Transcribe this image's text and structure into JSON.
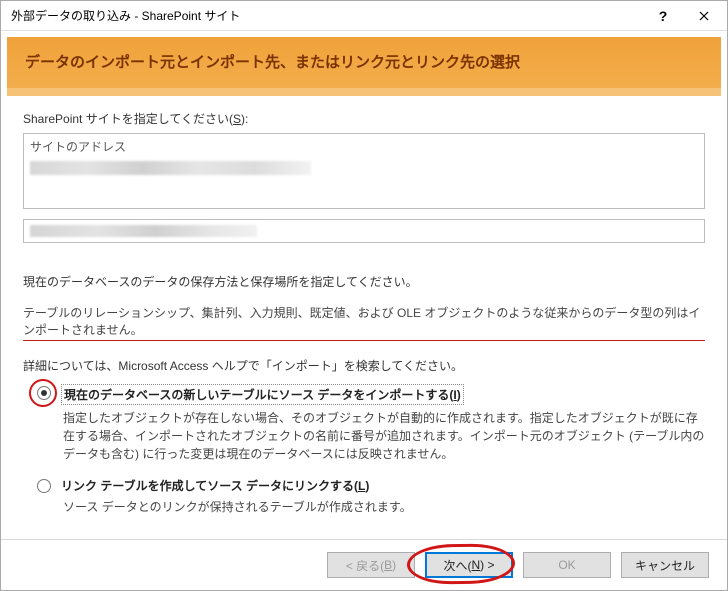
{
  "window": {
    "title": "外部データの取り込み - SharePoint サイト"
  },
  "banner": {
    "title": "データのインポート元とインポート先、またはリンク元とリンク先の選択"
  },
  "site_section": {
    "label_prefix": "SharePoint サイトを指定してください(",
    "label_key": "S",
    "label_suffix": "):",
    "listbox_header": "サイトのアドレス"
  },
  "instructions": {
    "storage_line": "現在のデータベースのデータの保存方法と保存場所を指定してください。",
    "warning_line": "テーブルのリレーションシップ、集計列、入力規則、既定値、および OLE オブジェクトのような従来からのデータ型の列はインポートされません。",
    "help_line": "詳細については、Microsoft Access ヘルプで「インポート」を検索してください。"
  },
  "options": {
    "import_new": {
      "label_prefix": "現在のデータベースの新しいテーブルにソース データをインポートする(",
      "label_key": "I",
      "label_suffix": ")",
      "desc": "指定したオブジェクトが存在しない場合、そのオブジェクトが自動的に作成されます。指定したオブジェクトが既に存在する場合、インポートされたオブジェクトの名前に番号が追加されます。インポート元のオブジェクト (テーブル内のデータも含む) に行った変更は現在のデータベースには反映されません。",
      "checked": true
    },
    "link_table": {
      "label_prefix": "リンク テーブルを作成してソース データにリンクする(",
      "label_key": "L",
      "label_suffix": ")",
      "desc": "ソース データとのリンクが保持されるテーブルが作成されます。",
      "checked": false
    }
  },
  "buttons": {
    "back_prefix": "< 戻る(",
    "back_key": "B",
    "back_suffix": ")",
    "next_prefix": "次へ(",
    "next_key": "N",
    "next_suffix": ") >",
    "ok": "OK",
    "cancel": "キャンセル"
  }
}
